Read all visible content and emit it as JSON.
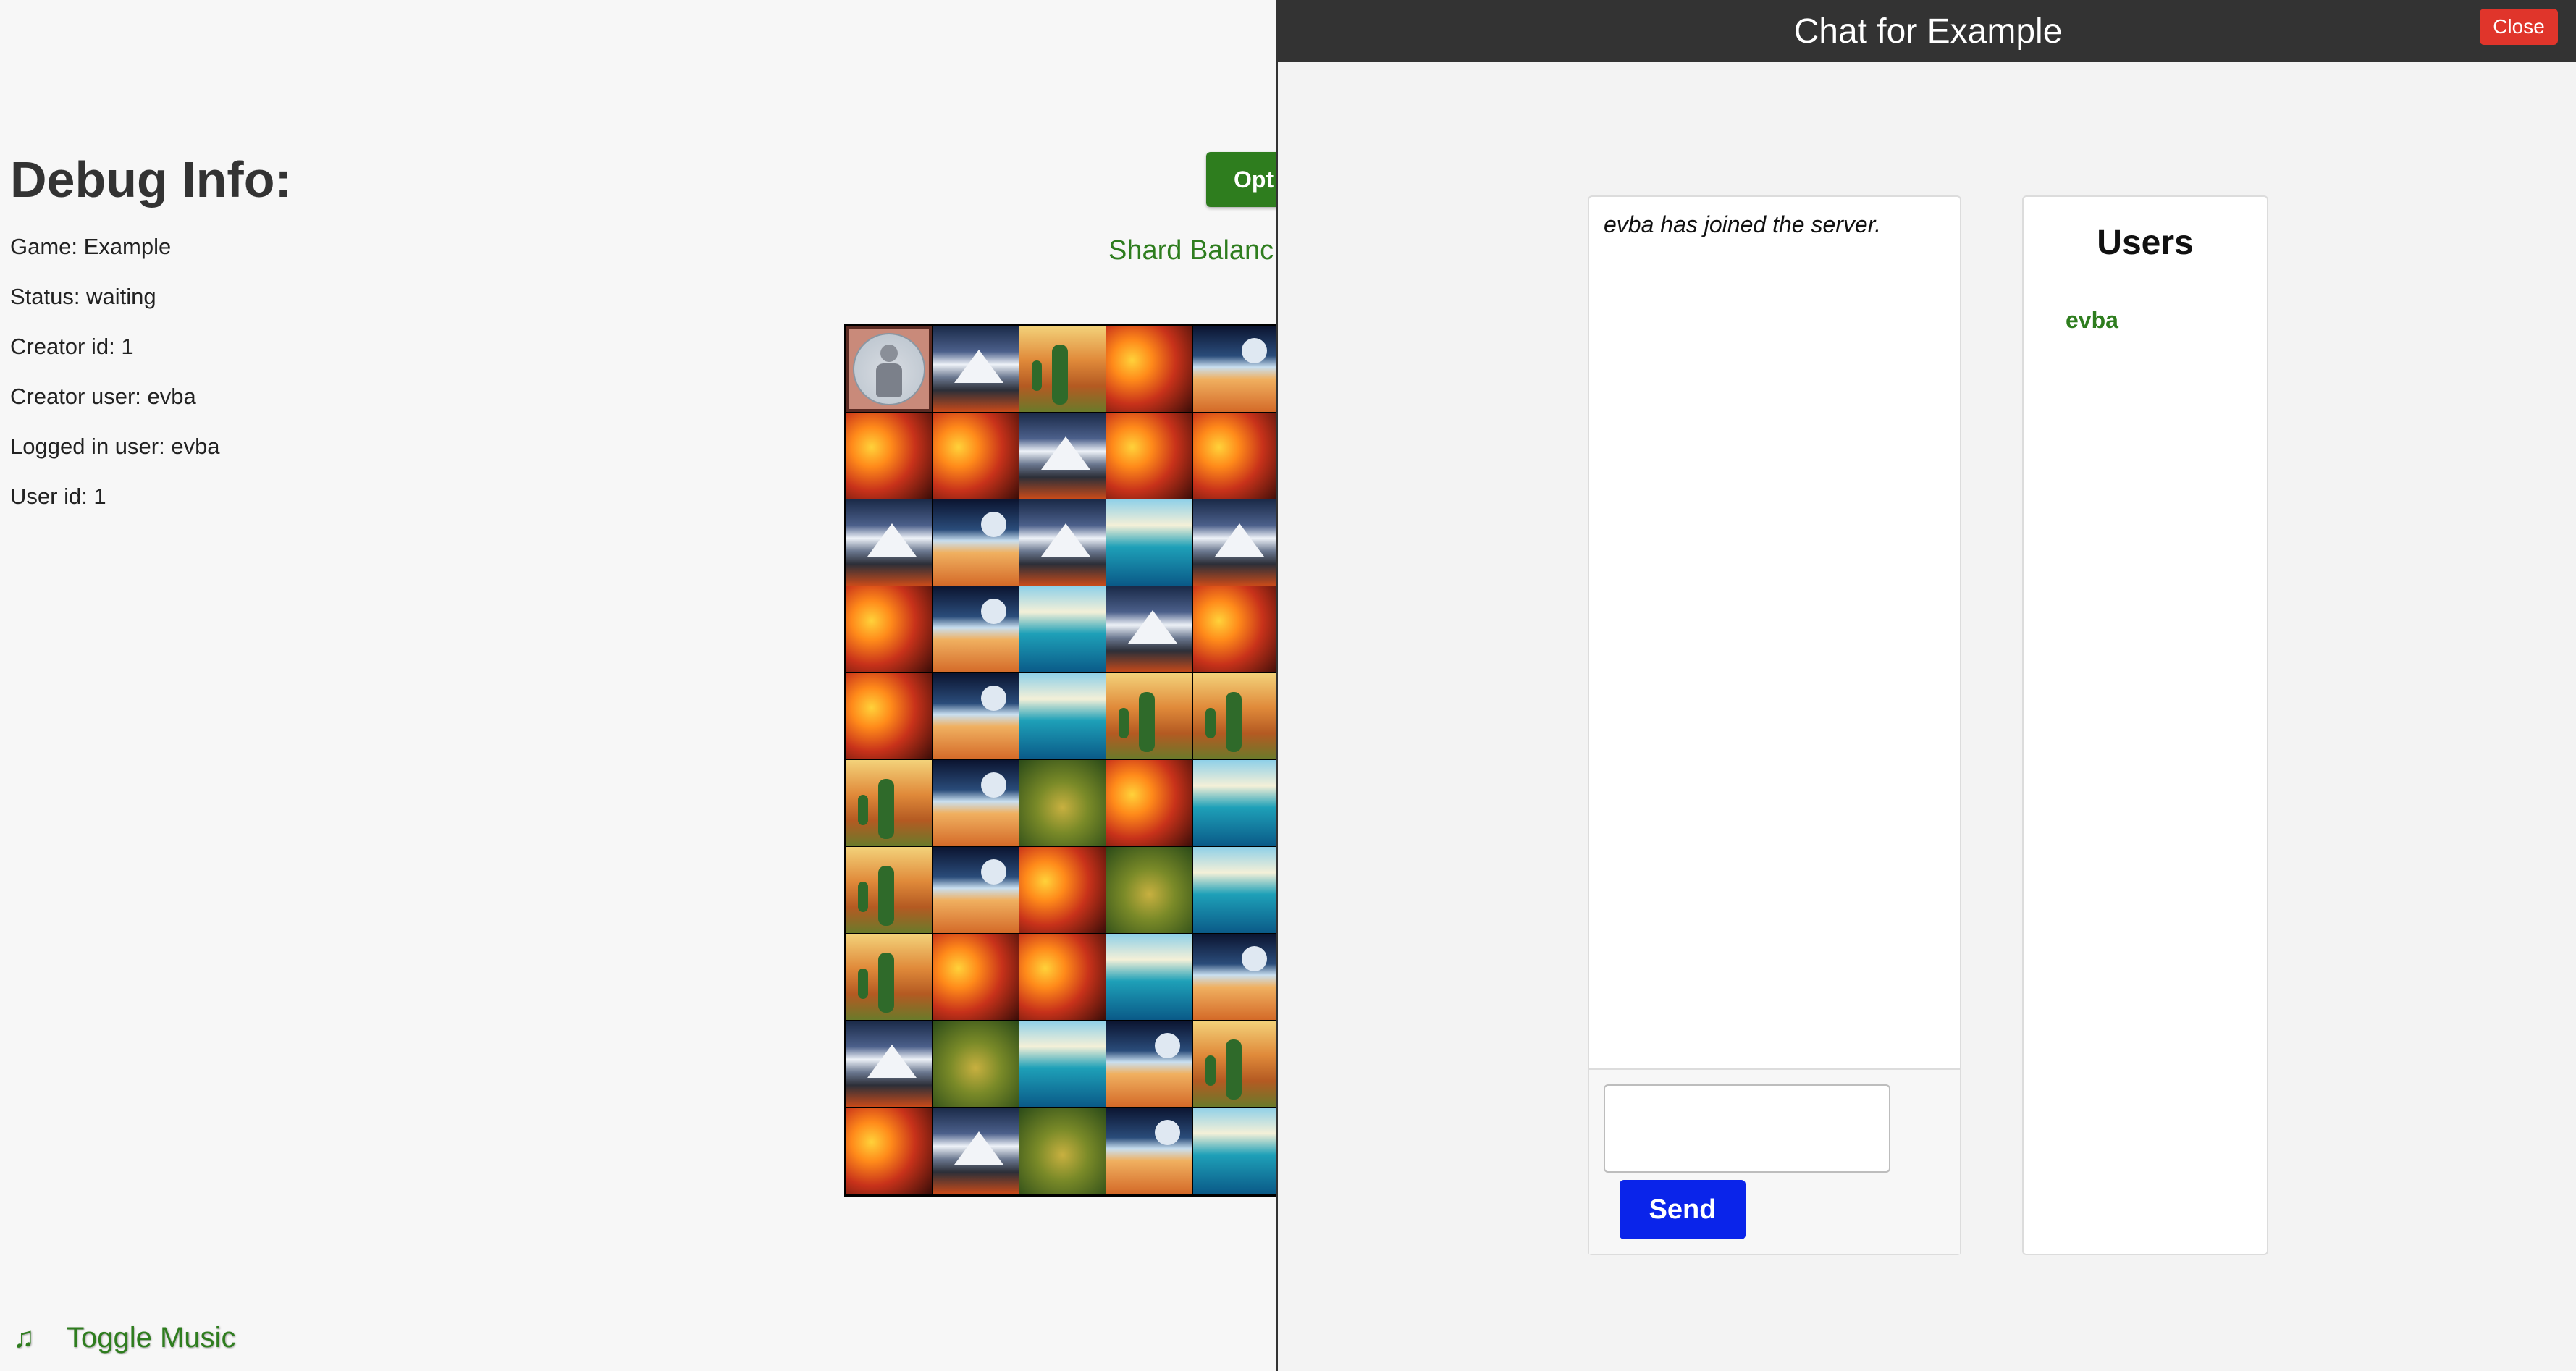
{
  "debug": {
    "title": "Debug Info:",
    "game": "Game: Example",
    "status": "Status: waiting",
    "creator_id": "Creator id: 1",
    "creator_user": "Creator user: evba",
    "logged_in_user": "Logged in user: evba",
    "user_id": "User id: 1"
  },
  "game_area": {
    "options_label": "Opt",
    "shard_balance_label": "Shard Balanc",
    "grid_rows": [
      [
        "player",
        "volcano",
        "cactus",
        "lava",
        "desert"
      ],
      [
        "lava",
        "lava",
        "volcano",
        "lava",
        "lava"
      ],
      [
        "volcano",
        "desert",
        "volcano",
        "wave",
        "volcano"
      ],
      [
        "lava",
        "desert",
        "wave",
        "volcano",
        "lava"
      ],
      [
        "lava",
        "desert",
        "wave",
        "cactus",
        "cactus"
      ],
      [
        "cactus",
        "desert",
        "grass",
        "lava",
        "wave"
      ],
      [
        "cactus",
        "desert",
        "lava",
        "grass",
        "wave"
      ],
      [
        "cactus",
        "lava",
        "lava",
        "wave",
        "desert"
      ],
      [
        "volcano",
        "grass",
        "wave",
        "desert",
        "cactus"
      ],
      [
        "lava",
        "volcano",
        "grass",
        "desert",
        "wave"
      ]
    ]
  },
  "music": {
    "icon": "music-note-icon",
    "label": "Toggle Music"
  },
  "chat": {
    "title": "Chat for Example",
    "close_label": "Close",
    "messages": [
      "evba has joined the server."
    ],
    "input_value": "",
    "send_label": "Send",
    "users_title": "Users",
    "users": [
      "evba"
    ]
  },
  "colors": {
    "accent_green": "#2e7d1e",
    "send_blue": "#0a24ea",
    "close_red": "#e0352b",
    "header_dark": "#333333"
  }
}
